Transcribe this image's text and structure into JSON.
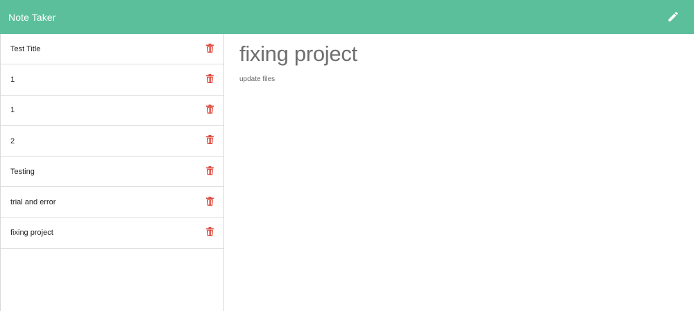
{
  "navbar": {
    "brand": "Note Taker",
    "new_note_icon": "pencil-icon",
    "background_color": "#5bbf9c"
  },
  "sidebar": {
    "delete_icon": "trash-icon",
    "delete_icon_color": "#e04b3f",
    "notes": [
      {
        "title": "Test Title"
      },
      {
        "title": "1"
      },
      {
        "title": "1"
      },
      {
        "title": "2"
      },
      {
        "title": "Testing"
      },
      {
        "title": "trial and error"
      },
      {
        "title": "fixing project"
      }
    ]
  },
  "active_note": {
    "title": "fixing project",
    "text": "update files"
  }
}
